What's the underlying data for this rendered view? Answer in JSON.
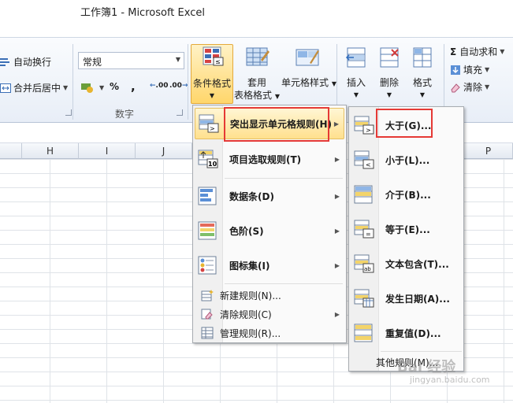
{
  "window": {
    "title": "工作簿1  -  Microsoft Excel"
  },
  "ribbon": {
    "wrap_text": "自动换行",
    "merge_center": "合并后居中",
    "number_format": "常规",
    "percent": "%",
    "comma": ",",
    "increase_decimal": ".00",
    "decrease_decimal": ".00",
    "number_group_label": "数字",
    "conditional_format": "条件格式",
    "format_as_table_1": "套用",
    "format_as_table_2": "表格格式",
    "cell_styles": "单元格样式",
    "insert": "插入",
    "delete": "删除",
    "format": "格式",
    "autosum": "自动求和",
    "fill": "填充",
    "clear": "清除"
  },
  "columns": {
    "h": "H",
    "i": "I",
    "j": "J",
    "p": "P"
  },
  "menu_main": {
    "highlight_rules": "突出显示单元格规则(H)",
    "top_bottom": "项目选取规则(T)",
    "data_bars": "数据条(D)",
    "color_scales": "色阶(S)",
    "icon_sets": "图标集(I)",
    "new_rule": "新建规则(N)...",
    "clear_rules": "清除规则(C)",
    "manage_rules": "管理规则(R)..."
  },
  "menu_sub": {
    "greater_than": "大于(G)...",
    "less_than": "小于(L)...",
    "between": "介于(B)...",
    "equal_to": "等于(E)...",
    "text_contains": "文本包含(T)...",
    "date_occurring": "发生日期(A)...",
    "duplicate_values": "重复值(D)...",
    "more_rules": "其他规则(M)..."
  },
  "watermark": {
    "main": "Bai 经验",
    "sub": "jingyan.baidu.com"
  },
  "colors": {
    "highlight": "#ffe08e",
    "annotation": "#e53935"
  }
}
